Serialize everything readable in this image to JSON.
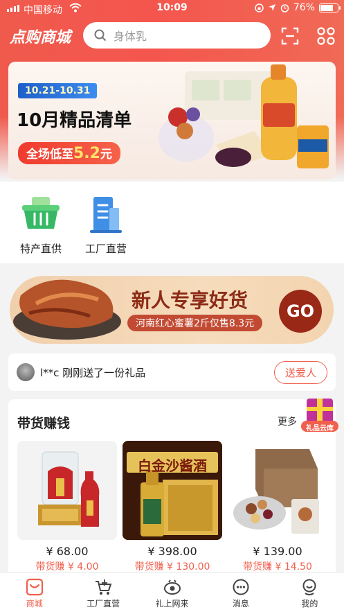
{
  "status_bar": {
    "carrier": "中国移动",
    "time": "10:09",
    "battery": "76%",
    "battery_level": 0.76
  },
  "header": {
    "brand": "点购商城",
    "search_placeholder": "身体乳"
  },
  "banner": {
    "date_range": "10.21-10.31",
    "title": "10月精品清单",
    "promo_prefix": "全场低至",
    "promo_value": "5.2",
    "promo_suffix": "元"
  },
  "categories": [
    {
      "label": "特产直供",
      "icon": "basket-icon"
    },
    {
      "label": "工厂直营",
      "icon": "building-icon"
    }
  ],
  "new_user_banner": {
    "title": "新人专享好货",
    "subtitle": "河南红心蜜薯2斤仅售8.3元",
    "go": "GO"
  },
  "notice": {
    "text": "l**c 刚刚送了一份礼品",
    "button": "送爱人"
  },
  "goods": {
    "heading": "带货赚钱",
    "more": "更多",
    "gift_label": "礼品云库",
    "items": [
      {
        "price": "¥ 68.00",
        "earn": "带货赚 ¥ 4.00"
      },
      {
        "price": "¥ 398.00",
        "earn": "带货赚 ¥ 130.00",
        "bottle_text": "白金沙酱酒"
      },
      {
        "price": "¥ 139.00",
        "earn": "带货赚 ¥ 14.50"
      }
    ]
  },
  "tabbar": [
    {
      "label": "商城",
      "icon": "mall-icon",
      "active": true
    },
    {
      "label": "工厂直营",
      "icon": "cart-icon",
      "active": false
    },
    {
      "label": "礼上网来",
      "icon": "eye-icon",
      "active": false
    },
    {
      "label": "消息",
      "icon": "message-icon",
      "active": false
    },
    {
      "label": "我的",
      "icon": "profile-icon",
      "active": false
    }
  ],
  "colors": {
    "brand": "#f0604d",
    "header": "#f4564d",
    "go_button": "#9a2817"
  }
}
